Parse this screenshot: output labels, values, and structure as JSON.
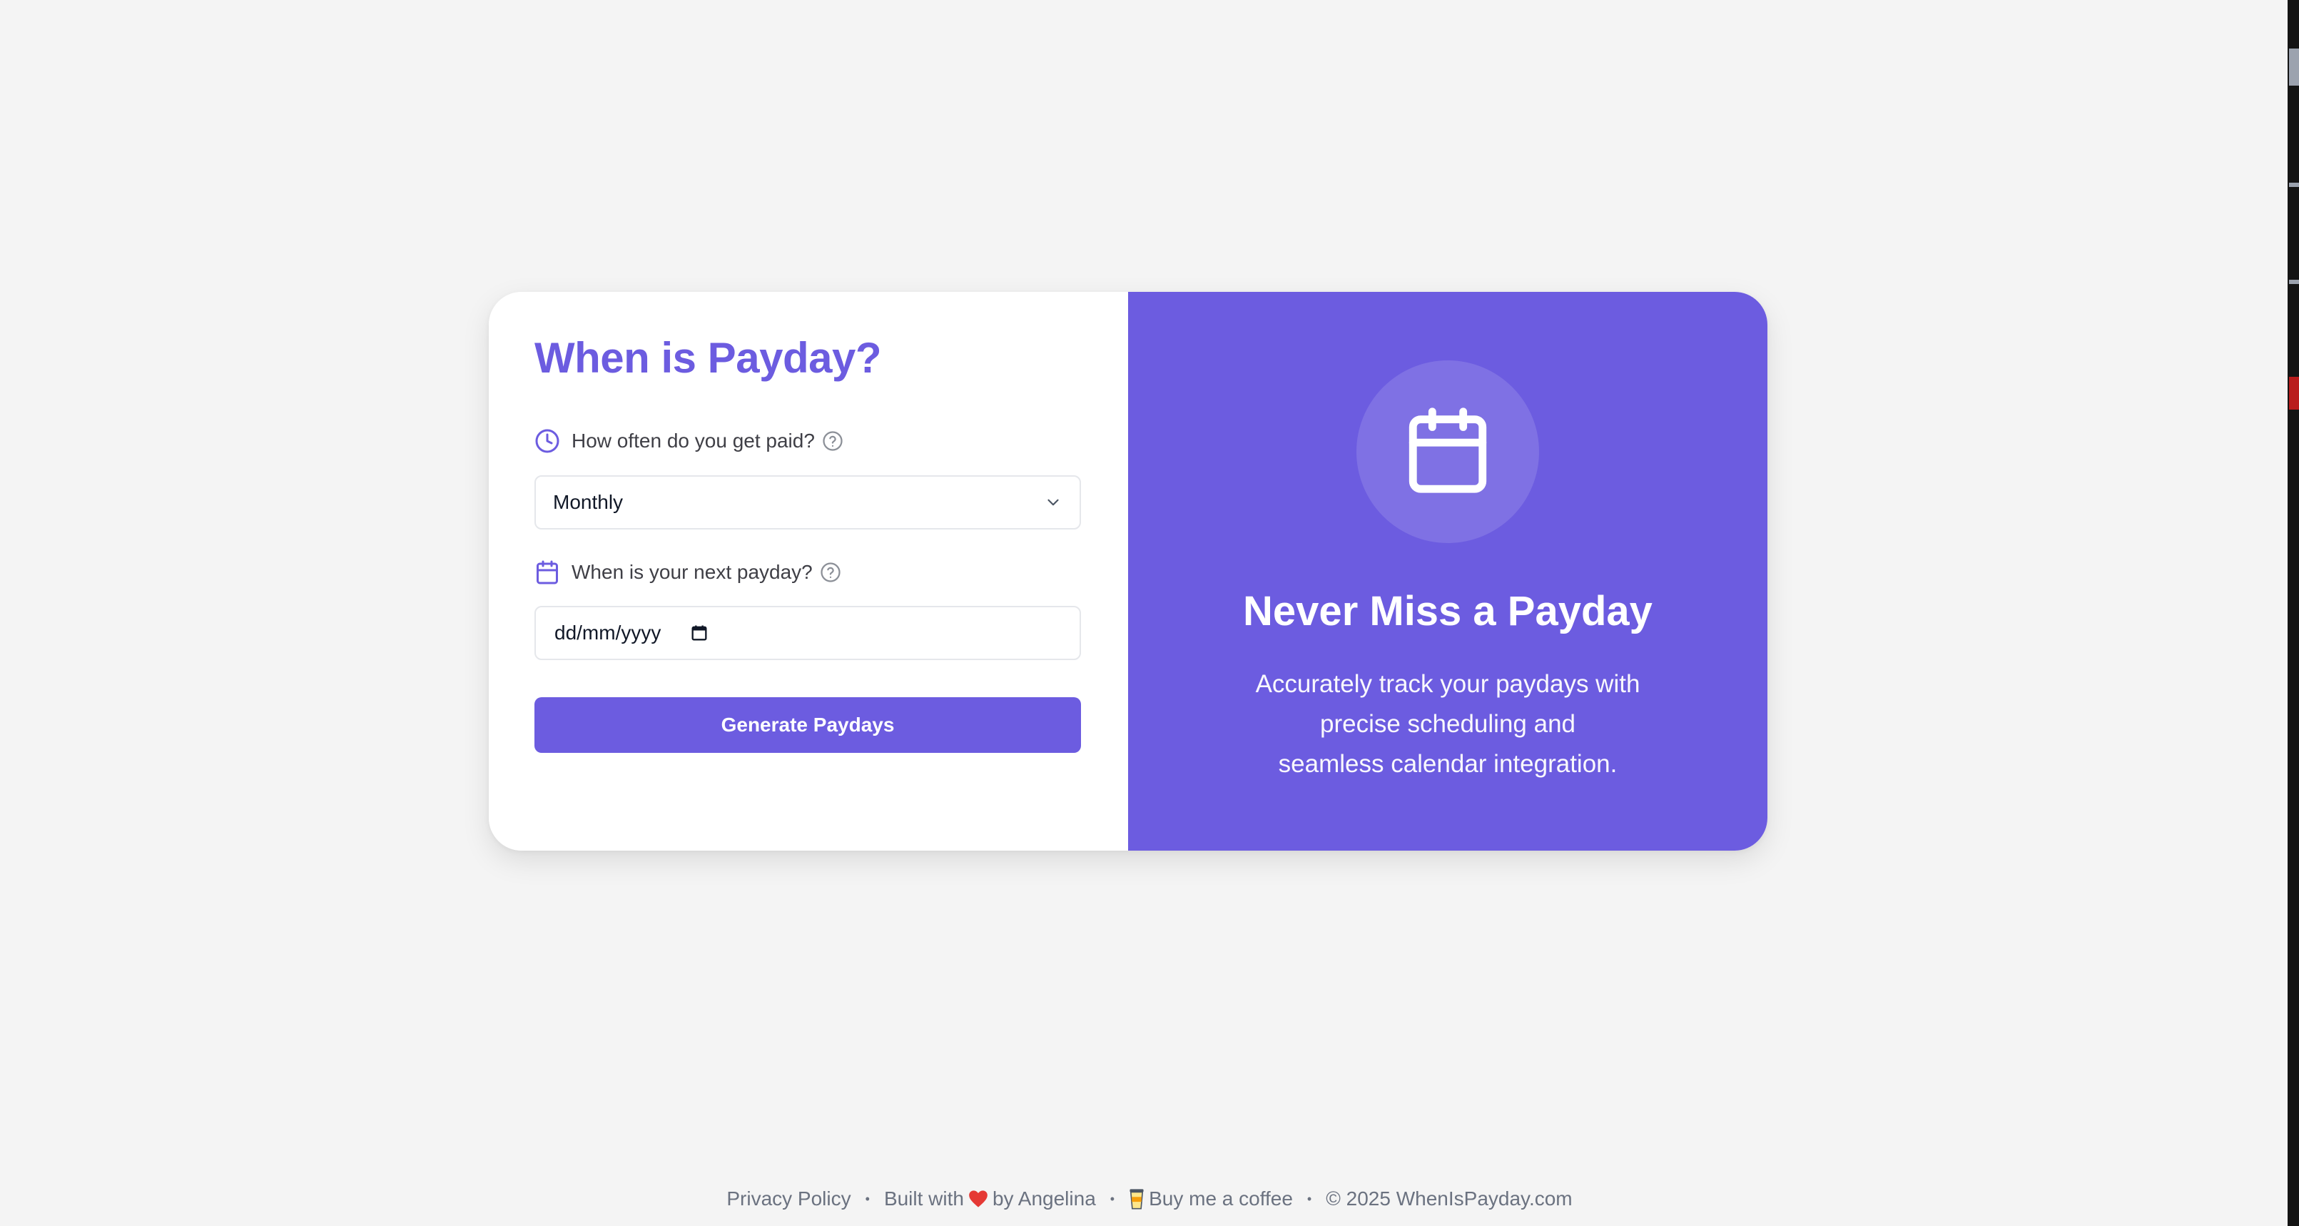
{
  "form": {
    "title": "When is Payday?",
    "frequency_label": "How often do you get paid?",
    "frequency_value": "Monthly",
    "next_payday_label": "When is your next payday?",
    "date_placeholder": "dd/mm/yyyy",
    "generate_button": "Generate Paydays"
  },
  "promo": {
    "title": "Never Miss a Payday",
    "line1": "Accurately track your paydays with",
    "line2": "precise scheduling and",
    "line3": "seamless calendar integration."
  },
  "footer": {
    "privacy": "Privacy Policy",
    "separator": "•",
    "built_with": "Built with",
    "by_author": "by Angelina",
    "coffee": "Buy me a coffee",
    "copyright": "© 2025 WhenIsPayday.com"
  },
  "colors": {
    "accent": "#6c5ce0",
    "background": "#f4f4f4",
    "heart": "#e53935"
  },
  "icons": {
    "frequency": "clock-icon",
    "next_payday": "calendar-icon",
    "help": "help-circle-icon",
    "select": "chevron-down-icon",
    "date_picker": "calendar-picker-icon",
    "promo": "calendar-icon",
    "heart": "heart-icon",
    "coffee": "coffee-cup-icon"
  }
}
